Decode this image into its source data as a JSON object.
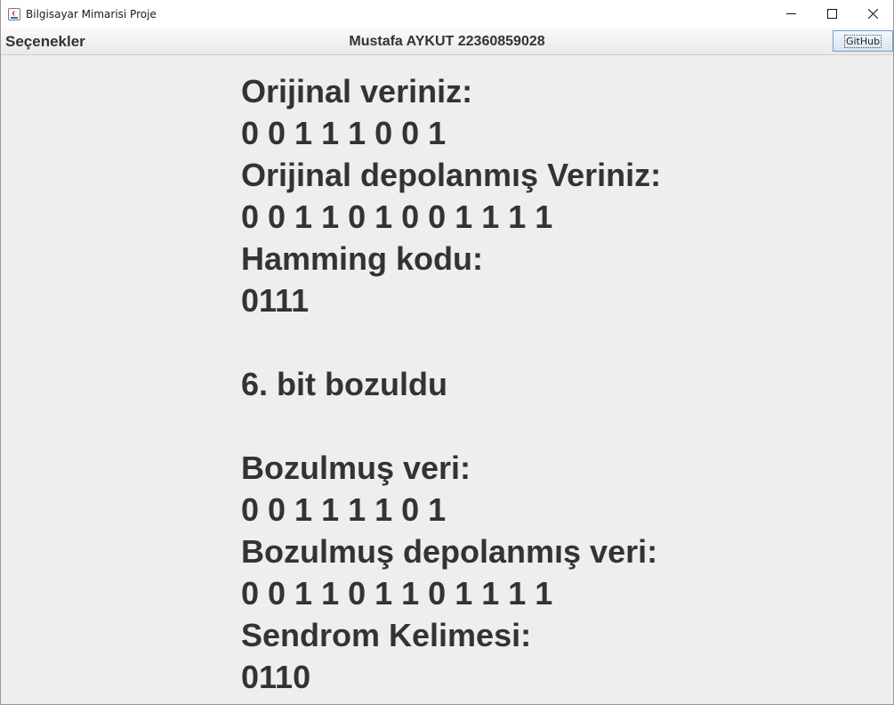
{
  "window": {
    "title": "Bilgisayar Mimarisi Proje"
  },
  "menubar": {
    "options_label": "Seçenekler",
    "author": "Mustafa AYKUT 22360859028",
    "github_label": "GitHub"
  },
  "content": {
    "original_data_label": "Orijinal veriniz:",
    "original_data": "0 0 1 1 1 0 0 1",
    "original_stored_label": "Orijinal depolanmış Veriniz:",
    "original_stored": "0 0 1 1 0 1 0 0 1 1 1 1",
    "hamming_label": "Hamming kodu:",
    "hamming_code": "0111",
    "corrupted_bit_message": "6. bit bozuldu",
    "corrupted_data_label": "Bozulmuş veri:",
    "corrupted_data": "0 0 1 1 1 1 0 1",
    "corrupted_stored_label": "Bozulmuş depolanmış veri:",
    "corrupted_stored": "0 0 1 1 0 1 1 0 1 1 1 1",
    "syndrome_label": "Sendrom Kelimesi:",
    "syndrome_word": "0110"
  }
}
